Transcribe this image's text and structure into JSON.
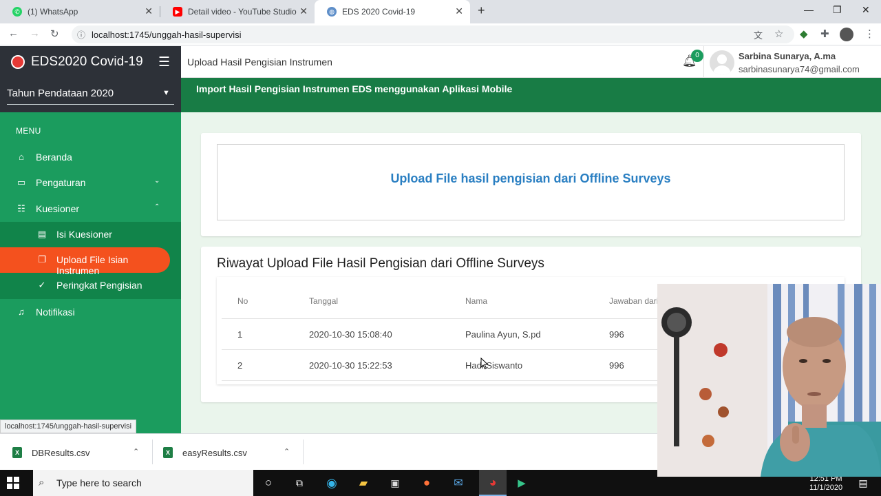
{
  "browser": {
    "tabs": [
      {
        "label": "(1) WhatsApp",
        "icon": "whatsapp-icon",
        "color": "#25d366"
      },
      {
        "label": "Detail video - YouTube Studio",
        "icon": "youtube-icon",
        "color": "#ff0000"
      },
      {
        "label": "EDS 2020 Covid-19",
        "icon": "globe-icon",
        "color": "#5f6368"
      }
    ],
    "new_tab": "+",
    "url": "localhost:1745/unggah-hasil-supervisi"
  },
  "sidebar": {
    "brand": "EDS2020 Covid-19",
    "year_select": "Tahun Pendataan 2020",
    "menu_header": "MENU",
    "items": [
      {
        "label": "Beranda",
        "icon": "home-icon"
      },
      {
        "label": "Pengaturan",
        "icon": "monitor-icon"
      },
      {
        "label": "Kuesioner",
        "icon": "list-icon"
      },
      {
        "label": "Isi Kuesioner",
        "icon": "form-icon"
      },
      {
        "label": "Upload File Isian Instrumen",
        "icon": "copy-icon"
      },
      {
        "label": "Peringkat Pengisian",
        "icon": "check-circle-icon"
      },
      {
        "label": "Notifikasi",
        "icon": "bell-icon"
      }
    ]
  },
  "header": {
    "page_title": "Upload Hasil Pengisian Instrumen",
    "notif_count": "0",
    "user_name": "Sarbina Sunarya, A.ma",
    "user_email": "sarbinasunarya74@gmail.com"
  },
  "main": {
    "banner": "Import Hasil Pengisian Instrumen EDS menggunakan Aplikasi Mobile",
    "upload_link": "Upload File hasil pengisian dari Offline Surveys",
    "history_title": "Riwayat Upload File Hasil Pengisian dari Offline Surveys",
    "table": {
      "headers": [
        "No",
        "Tanggal",
        "Nama",
        "Jawaban dari"
      ],
      "rows": [
        [
          "1",
          "2020-10-30 15:08:40",
          "Paulina Ayun, S.pd",
          "996"
        ],
        [
          "2",
          "2020-10-30 15:22:53",
          "Hadi Siswanto",
          "996"
        ]
      ]
    }
  },
  "status_url": "localhost:1745/unggah-hasil-supervisi",
  "downloads": [
    {
      "name": "DBResults.csv"
    },
    {
      "name": "easyResults.csv"
    }
  ],
  "taskbar": {
    "search_placeholder": "Type here to search",
    "time": "12:51 PM",
    "date": "11/1/2020"
  },
  "colors": {
    "sidebar_green": "#1b9c5e",
    "dark_header": "#2d3138",
    "active_orange": "#f4511e",
    "banner_green": "#187c45",
    "link_blue": "#2a7fc2"
  }
}
